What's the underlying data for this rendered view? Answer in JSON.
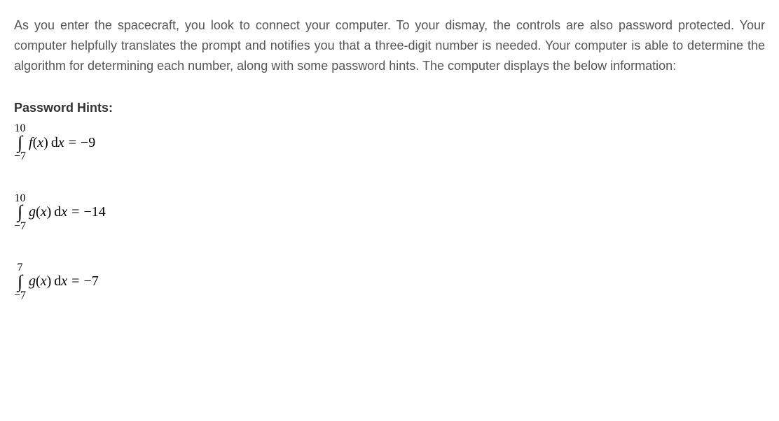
{
  "intro": "As you enter the spacecraft, you look to connect your computer. To your dismay, the controls are also password protected. Your computer helpfully translates the prompt and notifies you that a three-digit number is needed. Your computer is able to determine the algorithm for determining each number, along with some password hints. The computer displays the below information:",
  "hints_title": "Password Hints:",
  "equations": [
    {
      "upper": "10",
      "lower": "−7",
      "func": "f",
      "var": "x",
      "rhs": "−9"
    },
    {
      "upper": "10",
      "lower": "−7",
      "func": "g",
      "var": "x",
      "rhs": "−14"
    },
    {
      "upper": "7",
      "lower": "−7",
      "func": "g",
      "var": "x",
      "rhs": "−7"
    }
  ],
  "symbols": {
    "integral": "∫",
    "equals": "=",
    "d": "d",
    "open": "(",
    "close": ")"
  }
}
